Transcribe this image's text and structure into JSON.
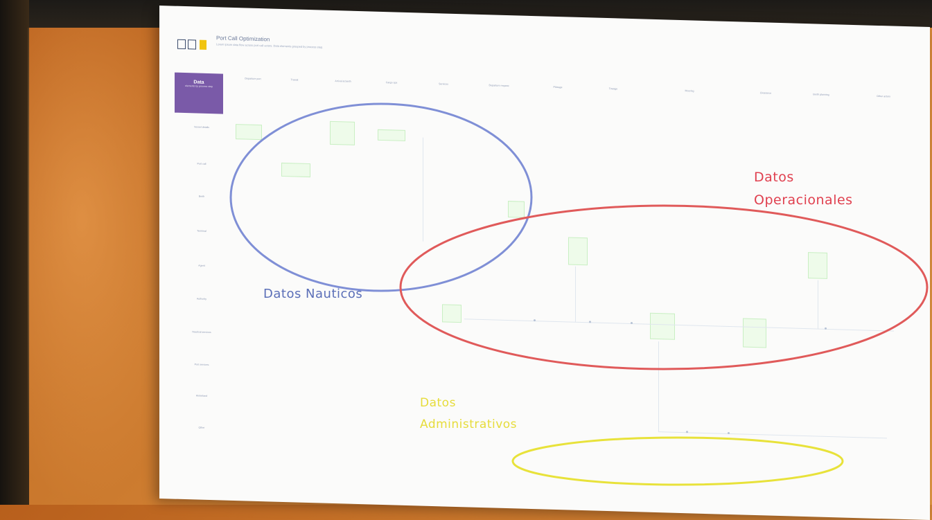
{
  "slide": {
    "title": "Port Call Optimization",
    "subtitle": "Lorem ipsum data flow across port call actors. Data elements grouped by process step.",
    "corner_cell": {
      "title": "Data",
      "subtitle": "elements by process step"
    },
    "column_headers": [
      "Departure port",
      "Transit",
      "Arrival at berth",
      "Cargo ops",
      "Services",
      "Departure request",
      "Pilotage",
      "Towage",
      "Mooring",
      "Clearance",
      "Berth planning",
      "Other actors"
    ],
    "row_labels": [
      "Vessel details",
      "Port call",
      "Berth",
      "Terminal",
      "Agent",
      "Authority",
      "Nautical services",
      "Port services",
      "Hinterland",
      "Other"
    ]
  },
  "annotations": {
    "nautical": {
      "label": "Datos Nauticos",
      "color": "#5b6fb8"
    },
    "operational": {
      "label_line1": "Datos",
      "label_line2": "Operacionales",
      "color": "#e0404f"
    },
    "administrative": {
      "label_line1": "Datos",
      "label_line2": "Administrativos",
      "color": "#e6dc3a"
    }
  },
  "colors": {
    "corner_cell": "#7a5aa8",
    "element_fill": "#eefbea",
    "element_border": "#c9efc3"
  }
}
